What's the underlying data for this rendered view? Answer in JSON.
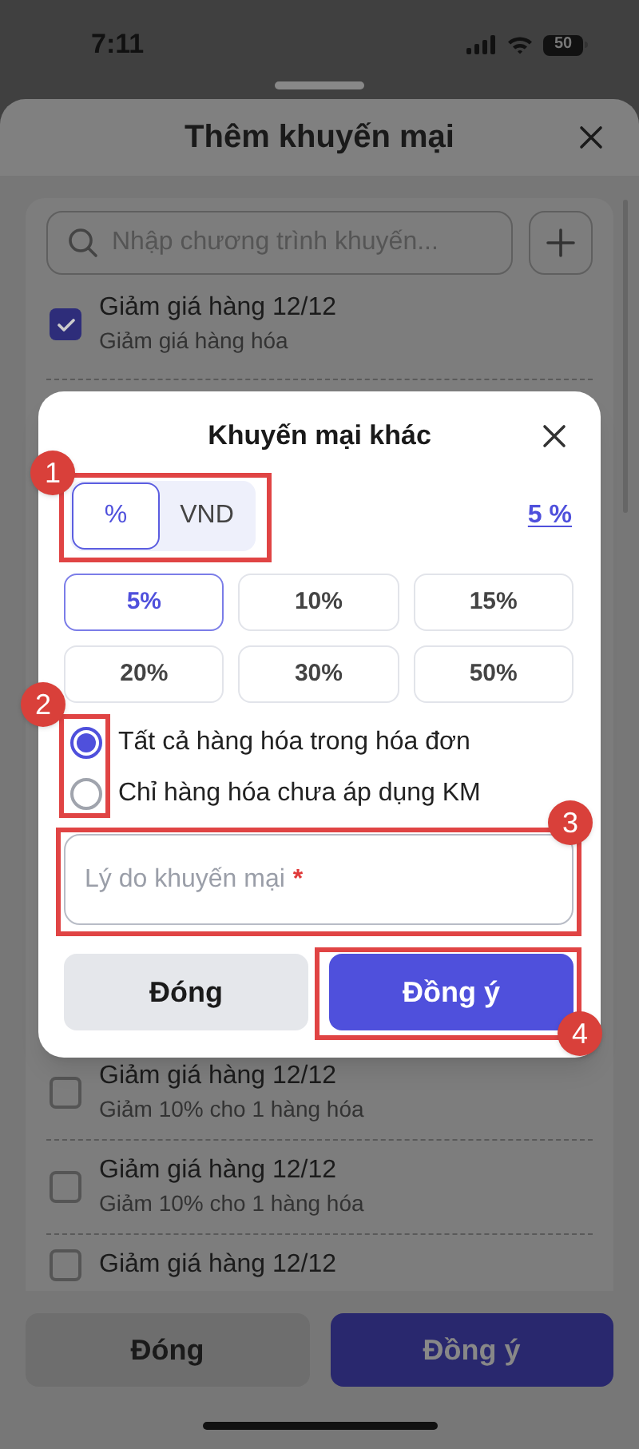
{
  "status_bar": {
    "time": "7:11",
    "battery": "50"
  },
  "sheet": {
    "title": "Thêm khuyến mại",
    "search": {
      "placeholder": "Nhập chương trình khuyến..."
    },
    "promotions": [
      {
        "title": "Giảm giá hàng 12/12",
        "subtitle": "Giảm giá hàng hóa",
        "checked": true
      },
      {
        "title": "Giảm giá hàng 12/12",
        "subtitle": "Giảm 10% cho 1 hàng hóa",
        "checked": false
      },
      {
        "title": "Giảm giá hàng 12/12",
        "subtitle": "Giảm 10% cho 1 hàng hóa",
        "checked": false
      },
      {
        "title": "Giảm giá hàng 12/12",
        "checked": false
      }
    ],
    "buttons": [
      {
        "label": "Đóng",
        "kind": "secondary"
      },
      {
        "label": "Đồng ý",
        "kind": "primary"
      }
    ]
  },
  "dialog": {
    "title": "Khuyến mại khác",
    "unit_tabs": [
      {
        "label": "%",
        "selected": true
      },
      {
        "label": "VND",
        "selected": false
      }
    ],
    "value_link": "5 %",
    "presets": [
      {
        "label": "5%",
        "selected": true
      },
      {
        "label": "10%",
        "selected": false
      },
      {
        "label": "15%",
        "selected": false
      },
      {
        "label": "20%",
        "selected": false
      },
      {
        "label": "30%",
        "selected": false
      },
      {
        "label": "50%",
        "selected": false
      }
    ],
    "scope_options": [
      {
        "label": "Tất cả hàng hóa trong hóa đơn",
        "selected": true
      },
      {
        "label": "Chỉ hàng hóa chưa áp dụng KM",
        "selected": false
      }
    ],
    "reason_field": {
      "placeholder": "Lý do khuyến mại",
      "required_mark": "*"
    },
    "buttons": [
      {
        "label": "Đóng",
        "kind": "secondary"
      },
      {
        "label": "Đồng ý",
        "kind": "primary"
      }
    ]
  },
  "annotations": [
    {
      "label": "1"
    },
    {
      "label": "2"
    },
    {
      "label": "3"
    },
    {
      "label": "4"
    }
  ]
}
